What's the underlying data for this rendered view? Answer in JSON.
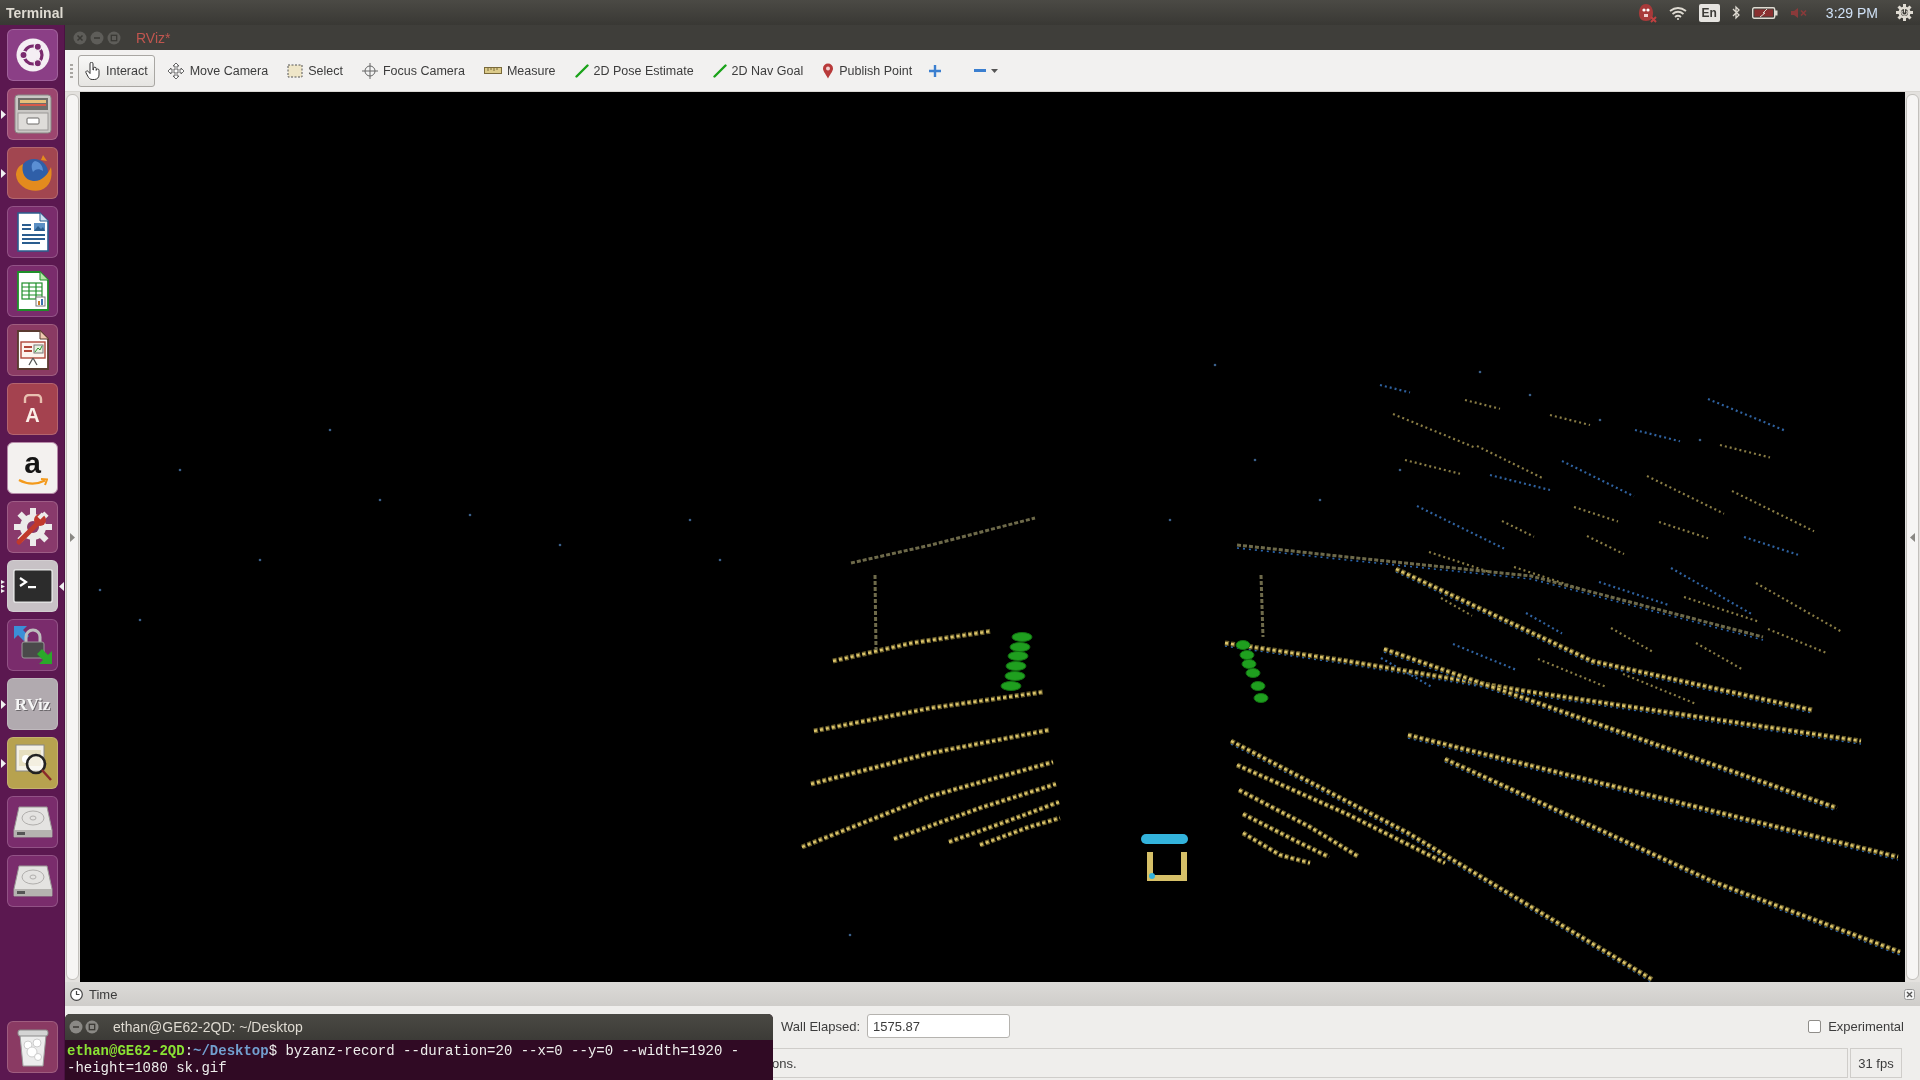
{
  "top_panel": {
    "app_name": "Terminal",
    "keyboard_layout": "En",
    "sound_muted": true,
    "clock": "3:29 PM"
  },
  "launcher": {
    "items": [
      {
        "kind": "dash",
        "running": false,
        "multiple_windows": false,
        "focused": false
      },
      {
        "kind": "files",
        "running": true,
        "multiple_windows": false,
        "focused": false
      },
      {
        "kind": "browser",
        "running": true,
        "multiple_windows": false,
        "focused": false
      },
      {
        "kind": "writer",
        "running": false,
        "multiple_windows": false,
        "focused": false
      },
      {
        "kind": "calc",
        "running": false,
        "multiple_windows": false,
        "focused": false
      },
      {
        "kind": "impress",
        "running": false,
        "multiple_windows": false,
        "focused": false
      },
      {
        "kind": "software",
        "glyph": "A",
        "running": false,
        "multiple_windows": false,
        "focused": false
      },
      {
        "kind": "amazon",
        "glyph": "a",
        "running": false,
        "multiple_windows": false,
        "focused": false
      },
      {
        "kind": "settings",
        "running": false,
        "multiple_windows": false,
        "focused": false
      },
      {
        "kind": "terminal",
        "running": true,
        "multiple_windows": true,
        "focused": true
      },
      {
        "kind": "passwords",
        "running": false,
        "multiple_windows": false,
        "focused": false
      },
      {
        "kind": "rviz",
        "glyph": "RViz",
        "running": true,
        "multiple_windows": false,
        "focused": false
      },
      {
        "kind": "image-viewer",
        "running": true,
        "multiple_windows": false,
        "focused": false
      },
      {
        "kind": "drive",
        "running": false,
        "multiple_windows": false,
        "focused": false
      },
      {
        "kind": "drive",
        "running": false,
        "multiple_windows": false,
        "focused": false
      },
      {
        "kind": "trash",
        "running": false,
        "multiple_windows": false,
        "focused": false
      }
    ]
  },
  "window": {
    "title": "RViz*"
  },
  "toolbar": {
    "tools": [
      {
        "kind": "interact",
        "label": "Interact",
        "selected": true
      },
      {
        "kind": "move-camera",
        "label": "Move Camera",
        "selected": false
      },
      {
        "kind": "select",
        "label": "Select",
        "selected": false
      },
      {
        "kind": "focus-camera",
        "label": "Focus Camera",
        "selected": false
      },
      {
        "kind": "measure",
        "label": "Measure",
        "selected": false
      },
      {
        "kind": "pose-estimate",
        "label": "2D Pose Estimate",
        "selected": false
      },
      {
        "kind": "nav-goal",
        "label": "2D Nav Goal",
        "selected": false
      },
      {
        "kind": "publish-point",
        "label": "Publish Point",
        "selected": false
      }
    ],
    "actions": [
      {
        "kind": "add"
      },
      {
        "kind": "remove"
      }
    ]
  },
  "time_panel": {
    "title": "Time",
    "wall_elapsed": {
      "label": "Wall Elapsed:",
      "value": "1575.87"
    },
    "experimental": {
      "label": "Experimental",
      "checked": false
    }
  },
  "status_bar": {
    "message": "ons.",
    "fps": "31 fps"
  },
  "terminal": {
    "title": "ethan@GE62-2QD: ~/Desktop",
    "lines": [
      {
        "segments": [
          {
            "kind": "user",
            "text": "ethan@GE62-2QD"
          },
          {
            "kind": "plain",
            "text": ":"
          },
          {
            "kind": "path",
            "text": "~/Desktop"
          },
          {
            "kind": "plain",
            "text": "$ byzanz-record --duration=20 --x=0 --y=0 --width=1920 -"
          }
        ]
      },
      {
        "segments": [
          {
            "kind": "plain",
            "text": "-height=1080 sk.gif"
          }
        ]
      }
    ]
  }
}
